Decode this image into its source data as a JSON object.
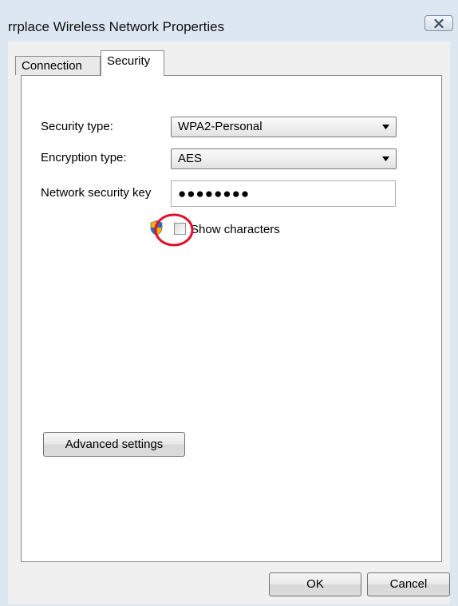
{
  "window": {
    "title": "rrplace Wireless Network Properties",
    "close_icon": "close-icon"
  },
  "tabs": [
    {
      "label": "Connection",
      "active": false
    },
    {
      "label": "Security",
      "active": true
    }
  ],
  "security": {
    "security_type_label": "Security type:",
    "security_type_value": "WPA2-Personal",
    "encryption_type_label": "Encryption type:",
    "encryption_type_value": "AES",
    "key_label": "Network security key",
    "key_value": "●●●●●●●●",
    "show_characters_label": "Show characters",
    "show_characters_checked": false,
    "shield_icon": "uac-shield-icon",
    "highlight_color": "#e0102a"
  },
  "buttons": {
    "advanced": "Advanced settings",
    "ok": "OK",
    "cancel": "Cancel"
  }
}
